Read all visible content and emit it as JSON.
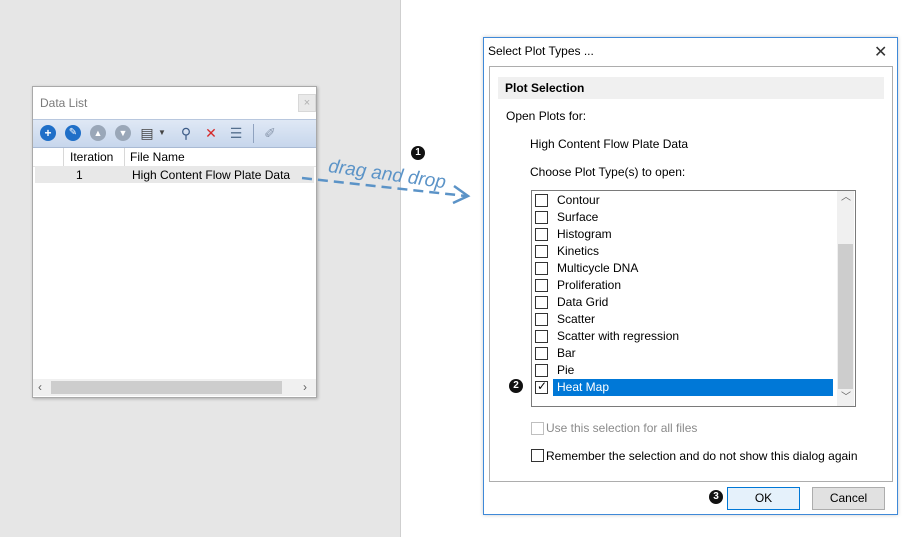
{
  "data_list": {
    "title": "Data List",
    "columns": [
      "Iteration",
      "File Name"
    ],
    "rows": [
      {
        "iteration": "1",
        "file_name": "High Content Flow Plate Data"
      }
    ]
  },
  "annotation": {
    "arrow_text": "drag and drop",
    "step1": "1",
    "step2": "2",
    "step3": "3",
    "arrow_color": "#5b93c7"
  },
  "dialog": {
    "title": "Select Plot Types ...",
    "group_title": "Plot Selection",
    "open_plots_label": "Open Plots for:",
    "file_name": "High Content Flow Plate Data",
    "choose_label": "Choose Plot Type(s) to open:",
    "plot_types": [
      {
        "label": "Contour",
        "checked": false
      },
      {
        "label": "Surface",
        "checked": false
      },
      {
        "label": "Histogram",
        "checked": false
      },
      {
        "label": "Kinetics",
        "checked": false
      },
      {
        "label": "Multicycle DNA",
        "checked": false
      },
      {
        "label": "Proliferation",
        "checked": false
      },
      {
        "label": "Data Grid",
        "checked": false
      },
      {
        "label": "Scatter",
        "checked": false
      },
      {
        "label": "Scatter with regression",
        "checked": false
      },
      {
        "label": "Bar",
        "checked": false
      },
      {
        "label": "Pie",
        "checked": false
      },
      {
        "label": "Heat Map",
        "checked": true
      }
    ],
    "use_all_label": "Use this selection for all files",
    "remember_label": "Remember the selection and do not show this dialog again",
    "ok_label": "OK",
    "cancel_label": "Cancel",
    "selection_color": "#0078d7"
  }
}
